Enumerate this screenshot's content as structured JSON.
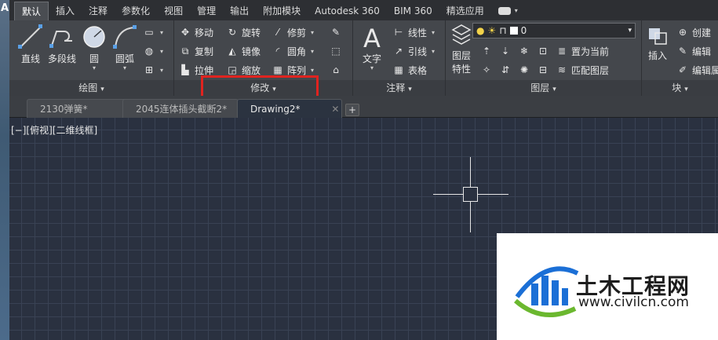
{
  "app": {
    "logo_letter": "A"
  },
  "menu": {
    "tabs": [
      "默认",
      "插入",
      "注释",
      "参数化",
      "视图",
      "管理",
      "输出",
      "附加模块",
      "Autodesk 360",
      "BIM 360",
      "精选应用"
    ],
    "active": "默认"
  },
  "ribbon": {
    "draw": {
      "footer": "绘图",
      "tools": {
        "line": "直线",
        "polyline": "多段线",
        "circle": "圆",
        "arc": "圆弧"
      }
    },
    "modify": {
      "footer": "修改",
      "tools": {
        "move": "移动",
        "rotate": "旋转",
        "trim": "修剪",
        "copy": "复制",
        "mirror": "镜像",
        "fillet": "圆角",
        "stretch": "拉伸",
        "scale": "缩放",
        "array": "阵列"
      }
    },
    "annotation": {
      "footer": "注释",
      "tools": {
        "text": "文字",
        "linear": "线性",
        "leader": "引线",
        "table": "表格"
      }
    },
    "layers": {
      "footer": "图层",
      "properties_label_line1": "图层",
      "properties_label_line2": "特性",
      "current_layer": "0",
      "tools": {
        "set_current": "置为当前",
        "match_layer": "匹配图层"
      }
    },
    "block": {
      "footer": "块",
      "tools": {
        "insert": "插入",
        "create": "创建",
        "edit": "编辑",
        "edit_attr": "编辑属"
      }
    }
  },
  "documents": {
    "tabs": [
      "2130弹簧*",
      "2045连体插头截断2*",
      "Drawing2*"
    ],
    "active": "Drawing2*",
    "add_label": "+",
    "close_label": "✕"
  },
  "canvas": {
    "view_label": "[−][俯视][二维线框]"
  },
  "watermark": {
    "title": "土木工程网",
    "url": "www.civilcn.com"
  },
  "colors": {
    "highlight": "#e0231f",
    "ribbon_bg": "#44474c",
    "canvas_bg": "#2a3140"
  }
}
